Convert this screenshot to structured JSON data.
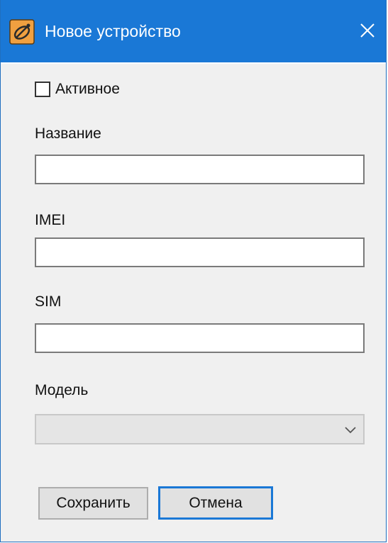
{
  "window": {
    "title": "Новое устройство",
    "icon": "satellite-icon",
    "close_glyph": "✕"
  },
  "form": {
    "active_checkbox": {
      "label": "Активное",
      "checked": false
    },
    "name": {
      "label": "Название",
      "value": ""
    },
    "imei": {
      "label": "IMEI",
      "value": ""
    },
    "sim": {
      "label": "SIM",
      "value": ""
    },
    "model": {
      "label": "Модель",
      "selected": "",
      "disabled": true
    }
  },
  "buttons": {
    "save_label": "Сохранить",
    "cancel_label": "Отмена"
  },
  "colors": {
    "titlebar": "#1a78d6",
    "focus_border": "#1a78d6",
    "background": "#f0f0f0",
    "icon_orange": "#f0a040"
  }
}
